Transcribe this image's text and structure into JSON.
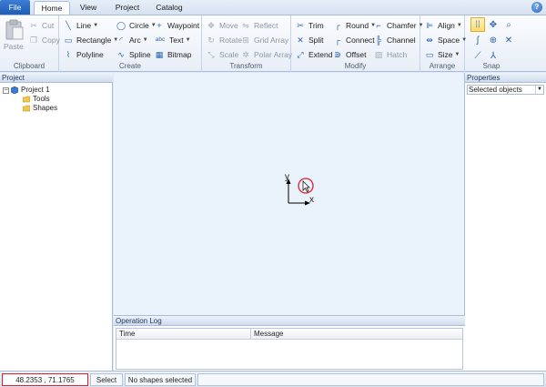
{
  "tabs": [
    {
      "label": "File"
    },
    {
      "label": "Home"
    },
    {
      "label": "View"
    },
    {
      "label": "Project"
    },
    {
      "label": "Catalog"
    }
  ],
  "help_icon": "help-icon",
  "ribbon": {
    "clipboard": {
      "label": "Clipboard",
      "paste": "Paste",
      "cut": "Cut",
      "copy": "Copy"
    },
    "create": {
      "label": "Create",
      "line": "Line",
      "rectangle": "Rectangle",
      "polyline": "Polyline",
      "circle": "Circle",
      "arc": "Arc",
      "spline": "Spline",
      "waypoint": "Waypoint",
      "text": "Text",
      "bitmap": "Bitmap",
      "text_icon": "abc"
    },
    "transform": {
      "label": "Transform",
      "move": "Move",
      "rotate": "Rotate",
      "scale": "Scale",
      "reflect": "Reflect",
      "grid_array": "Grid Array",
      "polar_array": "Polar Array"
    },
    "modify": {
      "label": "Modify",
      "trim": "Trim",
      "split": "Split",
      "extend": "Extend",
      "round": "Round",
      "connect": "Connect",
      "offset": "Offset",
      "chamfer": "Chamfer",
      "channel": "Channel",
      "hatch": "Hatch"
    },
    "arrange": {
      "label": "Arrange",
      "align": "Align",
      "space": "Space",
      "size": "Size"
    },
    "snap": {
      "label": "Snap"
    }
  },
  "project_panel": {
    "title": "Project",
    "root": "Project 1",
    "children": [
      "Tools",
      "Shapes"
    ]
  },
  "canvas": {
    "axis_x": "x",
    "axis_y": "y"
  },
  "operation_log": {
    "title": "Operation Log",
    "columns": [
      "Time",
      "Message"
    ]
  },
  "properties_panel": {
    "title": "Properties",
    "selected": "Selected objects"
  },
  "status": {
    "coordinates": "48.2353 , 71.1765",
    "mode": "Select",
    "selection": "No shapes selected"
  },
  "colors": {
    "accent": "#2a64b0",
    "file_tab": "#1f5cb4",
    "highlight": "#e01f26",
    "canvas": "#eaf2fb"
  }
}
